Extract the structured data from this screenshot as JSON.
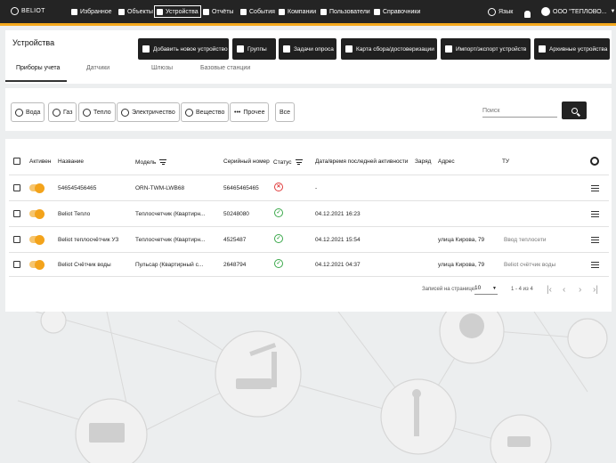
{
  "brand": {
    "logo_text": "BELIOT"
  },
  "topnav": {
    "items": [
      {
        "label": "Избранное",
        "icon": "favorites-icon"
      },
      {
        "label": "Объекты",
        "icon": "objects-icon"
      },
      {
        "label": "Устройства",
        "icon": "devices-icon",
        "active": true
      },
      {
        "label": "Отчёты",
        "icon": "reports-icon"
      },
      {
        "label": "События",
        "icon": "events-icon"
      },
      {
        "label": "Компании",
        "icon": "companies-icon"
      },
      {
        "label": "Пользователи",
        "icon": "users-icon"
      },
      {
        "label": "Справочники",
        "icon": "directories-icon"
      }
    ],
    "language_label": "Язык",
    "user_label": "ООО \"ТЕПЛОВО...",
    "accent_color": "#f4a81c"
  },
  "page": {
    "title": "Устройства",
    "actions": [
      {
        "label": "Добавить новое устройство"
      },
      {
        "label": "Группы"
      },
      {
        "label": "Задачи опроса"
      },
      {
        "label": "Карта сбора/достоверизации"
      },
      {
        "label": "Импорт/экспорт устройств"
      },
      {
        "label": "Архивные устройства"
      }
    ],
    "tabs": [
      "Приборы учета",
      "Датчики",
      "Шлюзы",
      "Базовые станции"
    ]
  },
  "filters": {
    "types": [
      "Вода",
      "Газ",
      "Тепло",
      "Электричество",
      "Вещество",
      "Прочее",
      "Все"
    ],
    "search_placeholder": "Поиск"
  },
  "table": {
    "headers": {
      "active": "Активен",
      "name": "Название",
      "model": "Модель",
      "serial": "Серийный номер",
      "status": "Статус",
      "last_activity": "Дата/время последней активности",
      "charge": "Заряд",
      "address": "Адрес",
      "tu": "ТУ"
    },
    "rows": [
      {
        "name": "546545456465",
        "model": "ORN-TWM-LWB68",
        "serial": "56465465465",
        "status": "error",
        "status_glyph": "✕",
        "last_activity": "-",
        "address": "",
        "tu": ""
      },
      {
        "name": "Beliot Тепло",
        "model": "Теплосчетчик (Квартирн...",
        "serial": "50248080",
        "status": "ok",
        "status_glyph": "✓",
        "last_activity": "04.12.2021 16:23",
        "address": "",
        "tu": ""
      },
      {
        "name": "Beliot теплосчётчик УЗ",
        "model": "Теплосчетчик (Квартирн...",
        "serial": "4525487",
        "status": "ok",
        "status_glyph": "✓",
        "last_activity": "04.12.2021 15:54",
        "address": "улица Кирова, 79",
        "tu": "Ввод теплосети"
      },
      {
        "name": "Beliot Счётчик воды",
        "model": "Пульсар (Квартирный с...",
        "serial": "2648794",
        "status": "ok",
        "status_glyph": "✓",
        "last_activity": "04.12.2021 04:37",
        "address": "улица Кирова, 79",
        "tu": "Beliot счётчик воды"
      }
    ]
  },
  "pagination": {
    "rows_per_page_label": "Записей на странице:",
    "rows_per_page": "10",
    "range_text": "1 - 4 из 4"
  }
}
